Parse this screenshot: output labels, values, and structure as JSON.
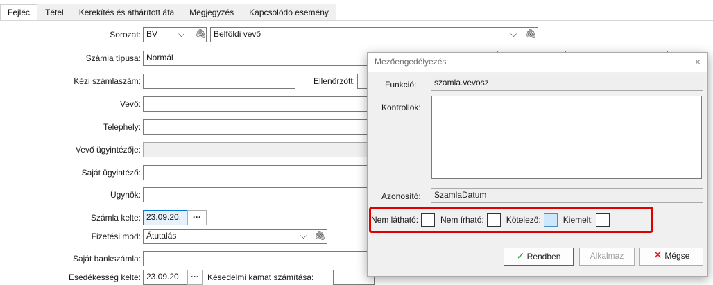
{
  "tabs": [
    "Fejléc",
    "Tétel",
    "Kerekítés és áthárított áfa",
    "Megjegyzés",
    "Kapcsolódó esemény"
  ],
  "form": {
    "sorozat_label": "Sorozat:",
    "sorozat_code": "BV",
    "sorozat_name": "Belföldi vevő",
    "szamla_tipusa_label": "Számla típusa:",
    "szamla_tipusa_value": "Normál",
    "kezi_szamlaszam_label": "Kézi számlaszám:",
    "ellenorzott_label": "Ellenőrzött:",
    "vevo_label": "Vevő:",
    "telephely_label": "Telephely:",
    "vevo_ugyintezoje_label": "Vevő ügyintézője:",
    "sajat_ugyintezo_label": "Saját ügyintéző:",
    "ugynok_label": "Ügynök:",
    "szamla_kelte_label": "Számla kelte:",
    "szamla_kelte_value": "23.09.20.",
    "fizetesi_mod_label": "Fizetési mód:",
    "fizetesi_mod_value": "Átutalás",
    "sajat_bankszamla_label": "Saját bankszámla:",
    "esedekesseg_label": "Esedékesség kelte:",
    "esedekesseg_value": "23.09.20.",
    "kesedelmi_label": "Késedelmi kamat számítása:",
    "ellipsis": "···"
  },
  "dialog": {
    "title": "Mezőengedélyezés",
    "close": "×",
    "funkcio_label": "Funkció:",
    "funkcio_value": "szamla.vevosz",
    "kontrollok_label": "Kontrollok:",
    "azonosito_label": "Azonosító:",
    "azonosito_value": "SzamlaDatum",
    "nem_lathato": "Nem látható:",
    "nem_irhato": "Nem írható:",
    "kotelezo": "Kötelező:",
    "kiemelt": "Kiemelt:",
    "ok_label": "Rendben",
    "apply_label": "Alkalmaz",
    "cancel_label": "Mégse"
  },
  "icons": {
    "dropdown": "chevron-down-icon",
    "attach": "paperclip-icon",
    "ok": "checkmark-icon",
    "cancel": "x-icon"
  },
  "colors": {
    "highlight_border": "#e00000",
    "focus_border": "#0078d7",
    "cancel_icon": "#e81123",
    "ok_icon": "#2e9e3f"
  }
}
